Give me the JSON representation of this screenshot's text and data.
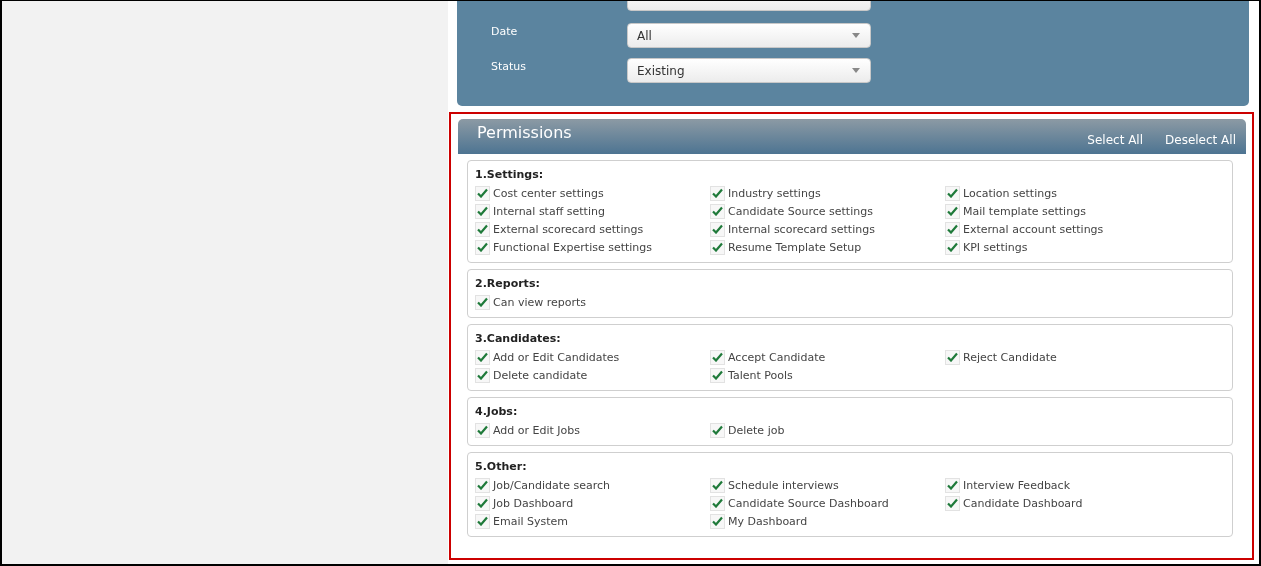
{
  "filters": [
    {
      "label": "Date",
      "value": "All"
    },
    {
      "label": "Status",
      "value": "Existing"
    }
  ],
  "permissions": {
    "title": "Permissions",
    "actions": [
      "Select All",
      "Deselect All"
    ],
    "sections": [
      {
        "title": "1.Settings:",
        "items": [
          {
            "label": "Cost center settings",
            "checked": true
          },
          {
            "label": "Industry settings",
            "checked": true
          },
          {
            "label": "Location settings",
            "checked": true
          },
          {
            "label": "Internal staff setting",
            "checked": true
          },
          {
            "label": "Candidate Source settings",
            "checked": true
          },
          {
            "label": "Mail template settings",
            "checked": true
          },
          {
            "label": "External scorecard settings",
            "checked": true
          },
          {
            "label": "Internal scorecard settings",
            "checked": true
          },
          {
            "label": "External account settings",
            "checked": true
          },
          {
            "label": "Functional Expertise settings",
            "checked": true
          },
          {
            "label": "Resume Template Setup",
            "checked": true
          },
          {
            "label": "KPI settings",
            "checked": true
          }
        ]
      },
      {
        "title": "2.Reports:",
        "items": [
          {
            "label": "Can view reports",
            "checked": true
          }
        ]
      },
      {
        "title": "3.Candidates:",
        "items": [
          {
            "label": "Add or Edit Candidates",
            "checked": true
          },
          {
            "label": "Accept Candidate",
            "checked": true
          },
          {
            "label": "Reject Candidate",
            "checked": true
          },
          {
            "label": "Delete candidate",
            "checked": true
          },
          {
            "label": "Talent Pools",
            "checked": true
          }
        ]
      },
      {
        "title": "4.Jobs:",
        "items": [
          {
            "label": "Add or Edit Jobs",
            "checked": true
          },
          {
            "label": "Delete job",
            "checked": true
          }
        ]
      },
      {
        "title": "5.Other:",
        "items": [
          {
            "label": "Job/Candidate search",
            "checked": true
          },
          {
            "label": "Schedule interviews",
            "checked": true
          },
          {
            "label": "Interview Feedback",
            "checked": true
          },
          {
            "label": "Job Dashboard",
            "checked": true
          },
          {
            "label": "Candidate Source Dashboard",
            "checked": true
          },
          {
            "label": "Candidate Dashboard",
            "checked": true
          },
          {
            "label": "Email System",
            "checked": true
          },
          {
            "label": "My Dashboard",
            "checked": true
          }
        ]
      }
    ]
  }
}
